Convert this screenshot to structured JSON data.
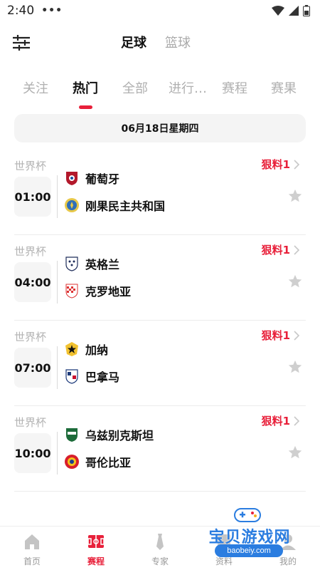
{
  "status_bar": {
    "time": "2:40",
    "dots": "•••"
  },
  "header": {
    "sport_tabs": [
      "足球",
      "篮球"
    ]
  },
  "category_tabs": [
    "关注",
    "热门",
    "全部",
    "进行…",
    "赛程",
    "赛果"
  ],
  "date_label": "06月18日星期四",
  "matches": [
    {
      "league": "世界杯",
      "time": "01:00",
      "home": "葡萄牙",
      "away": "刚果民主共和国",
      "tip": "狠料1"
    },
    {
      "league": "世界杯",
      "time": "04:00",
      "home": "英格兰",
      "away": "克罗地亚",
      "tip": "狠料1"
    },
    {
      "league": "世界杯",
      "time": "07:00",
      "home": "加纳",
      "away": "巴拿马",
      "tip": "狠料1"
    },
    {
      "league": "世界杯",
      "time": "10:00",
      "home": "乌兹别克斯坦",
      "away": "哥伦比亚",
      "tip": "狠料1"
    }
  ],
  "bottom_nav": [
    {
      "label": "首页",
      "icon": "home-icon"
    },
    {
      "label": "赛程",
      "icon": "pitch-icon"
    },
    {
      "label": "专家",
      "icon": "tie-icon"
    },
    {
      "label": "资料",
      "icon": "data-icon"
    },
    {
      "label": "我的",
      "icon": "user-icon"
    }
  ],
  "watermark": {
    "title": "宝贝游戏网",
    "url": "baobeiy.com"
  },
  "colors": {
    "accent": "#e8203a",
    "muted": "#b0b0b0",
    "watermark": "#2b7de0"
  }
}
